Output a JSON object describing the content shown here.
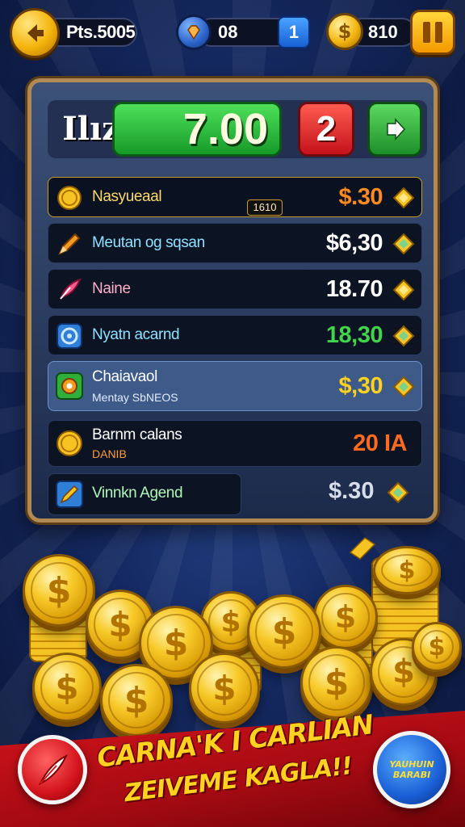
{
  "top_bar": {
    "points_label": "Pts.5005",
    "gems_value": "08",
    "badge_value": "1",
    "coins_value": "810"
  },
  "header": {
    "label": "Ilız",
    "score": "7.00",
    "count": "2"
  },
  "rows": [
    {
      "label": "Nasyueaal",
      "tag": "1610",
      "value": "$.30",
      "value_color": "#ff8a1f",
      "icon": "coin-icon",
      "diamond": "yellow"
    },
    {
      "label": "Meutan og sqsan",
      "value": "$6,30",
      "value_color": "#ffffff",
      "icon": "pencil-icon",
      "diamond": "green"
    },
    {
      "label": "Naine",
      "value": "18.70",
      "value_color": "#ffffff",
      "icon": "feather-icon",
      "diamond": "yellow"
    },
    {
      "label": "Nyatn acarnd",
      "value": "18,30",
      "value_color": "#43d34c",
      "icon": "target-icon",
      "diamond": "green"
    },
    {
      "label": "Chaiavaol",
      "sub_label": "Mentay SbNEOS",
      "value": "$,30",
      "value_color": "#ffd21f",
      "icon": "gear-icon",
      "diamond": "green"
    },
    {
      "label": "Barnm calans",
      "sub_label": "DANIB",
      "value": "20 IA",
      "value_color": "#ff6a1f",
      "icon": "coin-icon"
    },
    {
      "label": "Vinnkn Agend",
      "value": "$.30",
      "value_color": "#d6dcea",
      "icon": "pencil-icon",
      "diamond": "green"
    }
  ],
  "banner": {
    "line1": "CARNA'K I CARLIAN",
    "line2": "ZEIVEME KAGLA!!",
    "right_button": "YAUHUIN BARABI"
  },
  "colors": {
    "background": "#152a63",
    "panel_border": "#b08a52",
    "score_green": "#28b336",
    "count_red": "#d3141c",
    "banner_red": "#c4111a",
    "gold": "#f7c928"
  }
}
